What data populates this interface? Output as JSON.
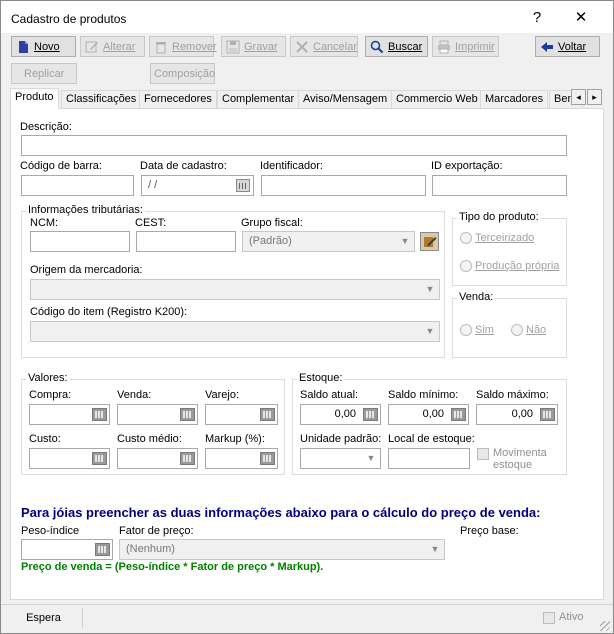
{
  "window": {
    "title": "Cadastro de produtos",
    "help_glyph": "?",
    "close_glyph": "✕"
  },
  "toolbar": {
    "novo": "Novo",
    "alterar": "Alterar",
    "remover": "Remover",
    "gravar": "Gravar",
    "cancelar": "Cancelar",
    "buscar": "Buscar",
    "imprimir": "Imprimir",
    "voltar": "Voltar",
    "replicar": "Replicar",
    "composicao": "Composição"
  },
  "tabs": [
    {
      "label": "Produto"
    },
    {
      "label": "Classificações"
    },
    {
      "label": "Fornecedores"
    },
    {
      "label": "Complementar"
    },
    {
      "label": "Aviso/Mensagem"
    },
    {
      "label": "Commercio Web"
    },
    {
      "label": "Marcadores"
    },
    {
      "label": "Ben"
    }
  ],
  "tab_scroll": {
    "left": "◂",
    "right": "▸"
  },
  "form": {
    "descricao": "Descrição:",
    "codigo_barra": "Código de barra:",
    "data_cadastro": "Data de cadastro:",
    "data_cadastro_value": " / /",
    "identificador": "Identificador:",
    "id_exportacao": "ID exportação:"
  },
  "tributarias": {
    "title": "Informações tributárias:",
    "ncm": "NCM:",
    "cest": "CEST:",
    "grupo_fiscal": "Grupo fiscal:",
    "grupo_fiscal_value": "(Padrão)",
    "origem": "Origem da mercadoria:",
    "codigo_item": "Código do item (Registro K200):"
  },
  "tipo_produto": {
    "title": "Tipo do produto:",
    "terceirizado": "Terceirizado",
    "producao": "Produção própria"
  },
  "venda": {
    "title": "Venda:",
    "sim": "Sim",
    "nao": "Não"
  },
  "valores": {
    "title": "Valores:",
    "compra": "Compra:",
    "venda": "Venda:",
    "varejo": "Varejo:",
    "custo": "Custo:",
    "custo_medio": "Custo médio:",
    "markup": "Markup (%):"
  },
  "estoque": {
    "title": "Estoque:",
    "saldo_atual": "Saldo atual:",
    "saldo_minimo": "Saldo mínimo:",
    "saldo_maximo": "Saldo máximo:",
    "saldo_atual_value": "0,00",
    "saldo_minimo_value": "0,00",
    "saldo_maximo_value": "0,00",
    "unidade_padrao": "Unidade padrão:",
    "local_estoque": "Local de estoque:",
    "movimenta_estoque": "Movimenta estoque"
  },
  "joias": {
    "heading": "Para jóias preencher as duas informações abaixo para o cálculo do preço de venda:",
    "peso_indice": "Peso-índice",
    "fator_preco": "Fator de preço:",
    "fator_preco_value": "(Nenhum)",
    "preco_base": "Preço base:",
    "formula": "Preço de venda = (Peso-índice * Fator de preço * Markup)."
  },
  "status": {
    "state": "Espera",
    "ativo": "Ativo"
  },
  "colors": {
    "heading_blue": "#00007f",
    "formula_green": "#008000"
  }
}
